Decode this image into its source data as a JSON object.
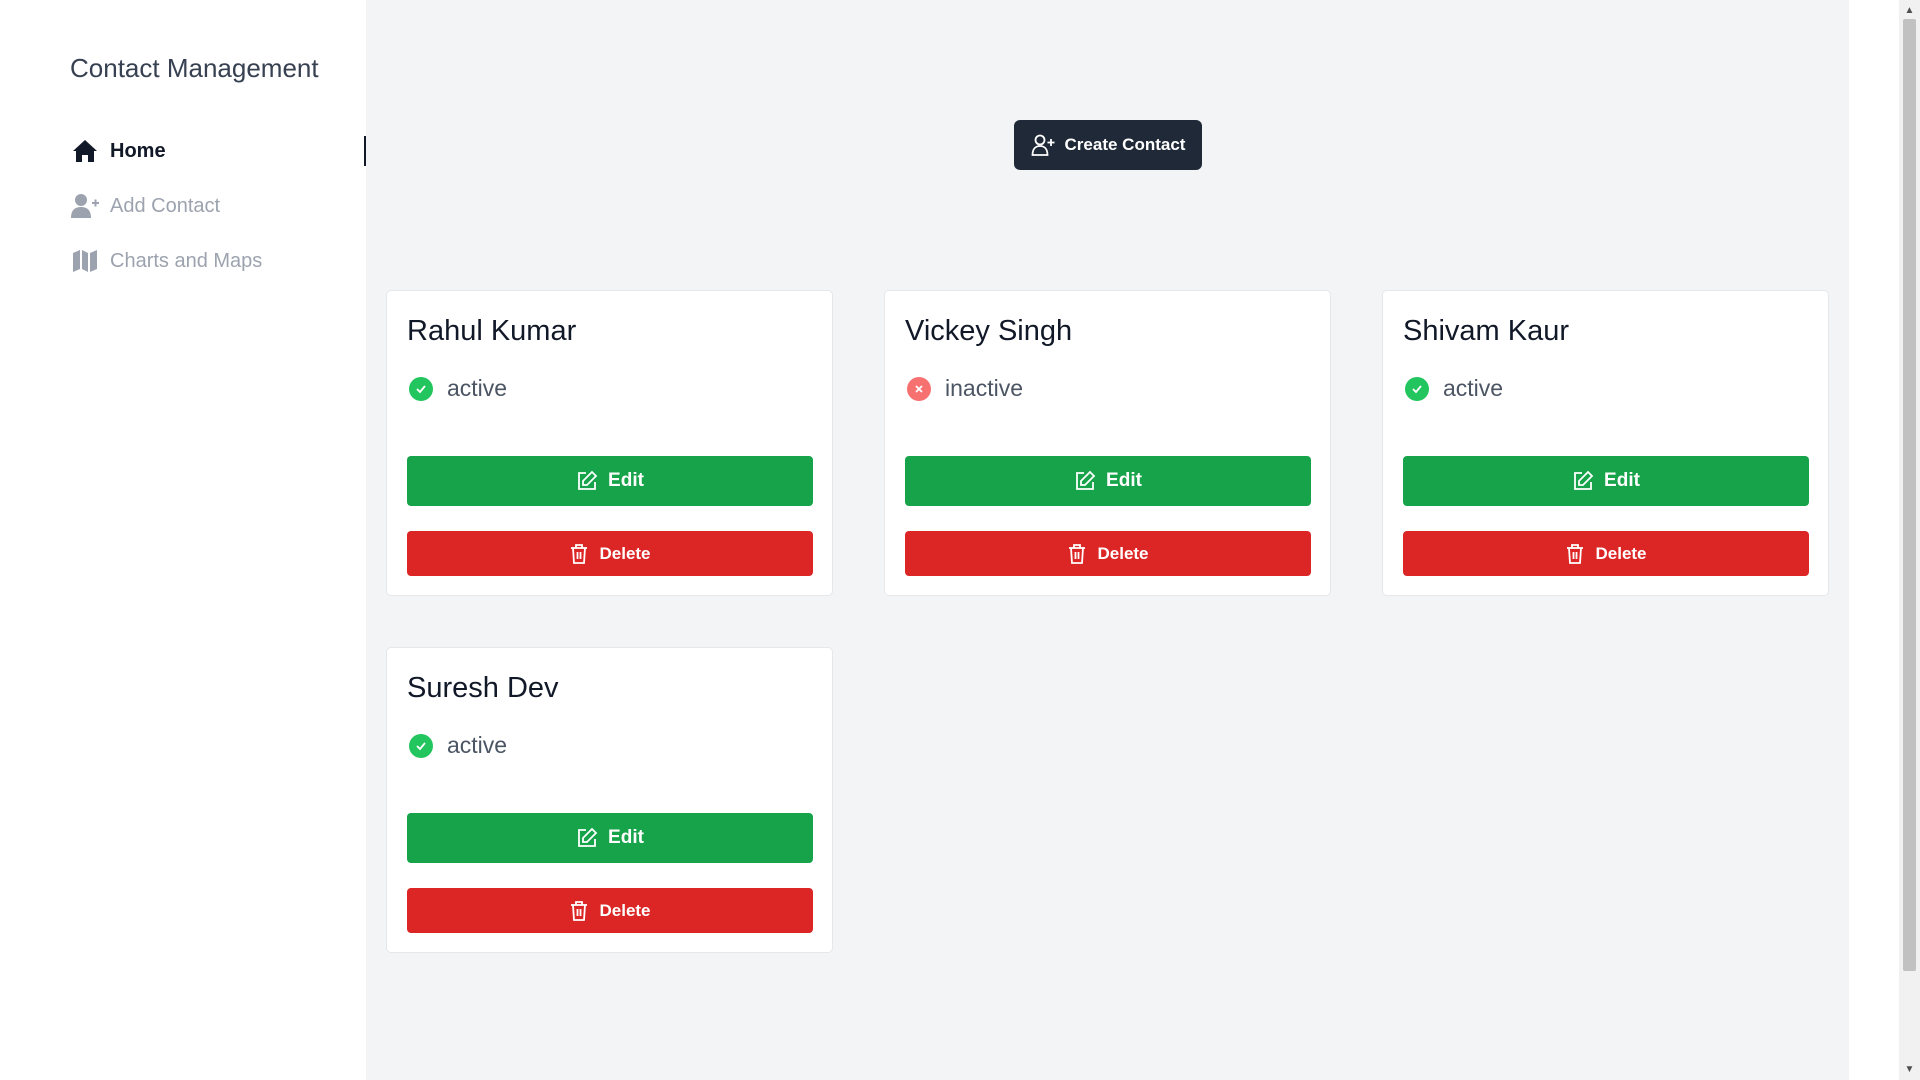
{
  "sidebar": {
    "title": "Contact Management",
    "items": [
      {
        "label": "Home",
        "icon": "home-icon",
        "active": true
      },
      {
        "label": "Add Contact",
        "icon": "user-plus-icon",
        "active": false
      },
      {
        "label": "Charts and Maps",
        "icon": "map-icon",
        "active": false
      }
    ]
  },
  "main": {
    "create_label": "Create Contact",
    "edit_label": "Edit",
    "delete_label": "Delete",
    "contacts": [
      {
        "name": "Rahul Kumar",
        "status": "active"
      },
      {
        "name": "Vickey Singh",
        "status": "inactive"
      },
      {
        "name": "Shivam Kaur",
        "status": "active"
      },
      {
        "name": "Suresh Dev",
        "status": "active"
      }
    ]
  },
  "colors": {
    "edit": "#16a34a",
    "delete": "#dc2626",
    "create": "#1f2937",
    "active_status": "#22c55e",
    "inactive_status": "#f87171"
  }
}
